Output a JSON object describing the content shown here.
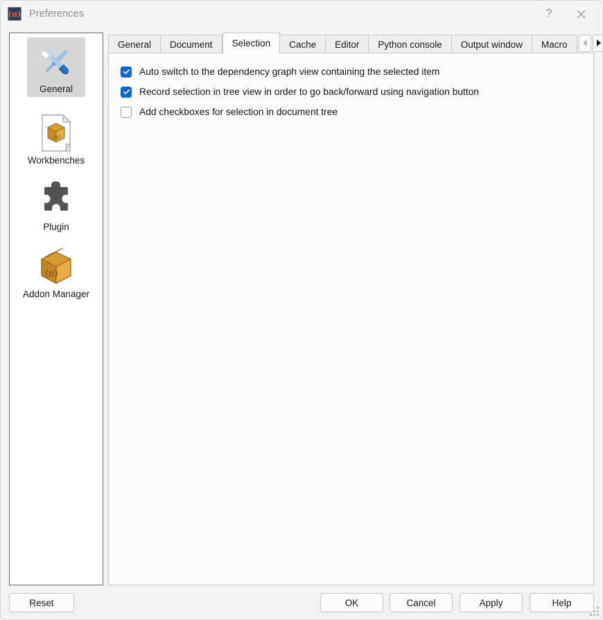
{
  "window": {
    "title": "Preferences",
    "app_icon": "freecad-pi-icon",
    "help_button": "?",
    "close_button": "✕"
  },
  "sidebar": {
    "items": [
      {
        "label": "General",
        "icon": "tools-wrench-screwdriver-icon",
        "selected": true
      },
      {
        "label": "Workbenches",
        "icon": "document-box-icon",
        "selected": false
      },
      {
        "label": "Plugin",
        "icon": "puzzle-piece-icon",
        "selected": false
      },
      {
        "label": "Addon Manager",
        "icon": "cardboard-box-icon",
        "selected": false
      }
    ]
  },
  "tabs": {
    "items": [
      {
        "label": "General",
        "active": false
      },
      {
        "label": "Document",
        "active": false
      },
      {
        "label": "Selection",
        "active": true
      },
      {
        "label": "Cache",
        "active": false
      },
      {
        "label": "Editor",
        "active": false
      },
      {
        "label": "Python console",
        "active": false
      },
      {
        "label": "Output window",
        "active": false
      },
      {
        "label": "Macro",
        "active": false
      }
    ],
    "scroll_left_icon": "chevron-left-icon",
    "scroll_right_icon": "chevron-right-icon",
    "scroll_left_enabled": false,
    "scroll_right_enabled": true
  },
  "selection_panel": {
    "options": [
      {
        "label": "Auto switch to the dependency graph view containing the selected item",
        "checked": true
      },
      {
        "label": "Record selection in tree view in order to go back/forward using navigation button",
        "checked": true
      },
      {
        "label": "Add checkboxes for selection in document tree",
        "checked": false
      }
    ]
  },
  "footer": {
    "reset_label": "Reset",
    "ok_label": "OK",
    "cancel_label": "Cancel",
    "apply_label": "Apply",
    "help_label": "Help"
  },
  "colors": {
    "accent_checkbox": "#1266cc",
    "window_bg": "#f3f3f3",
    "panel_bg": "#fcfcfc",
    "title_text": "#8d8d8d"
  }
}
